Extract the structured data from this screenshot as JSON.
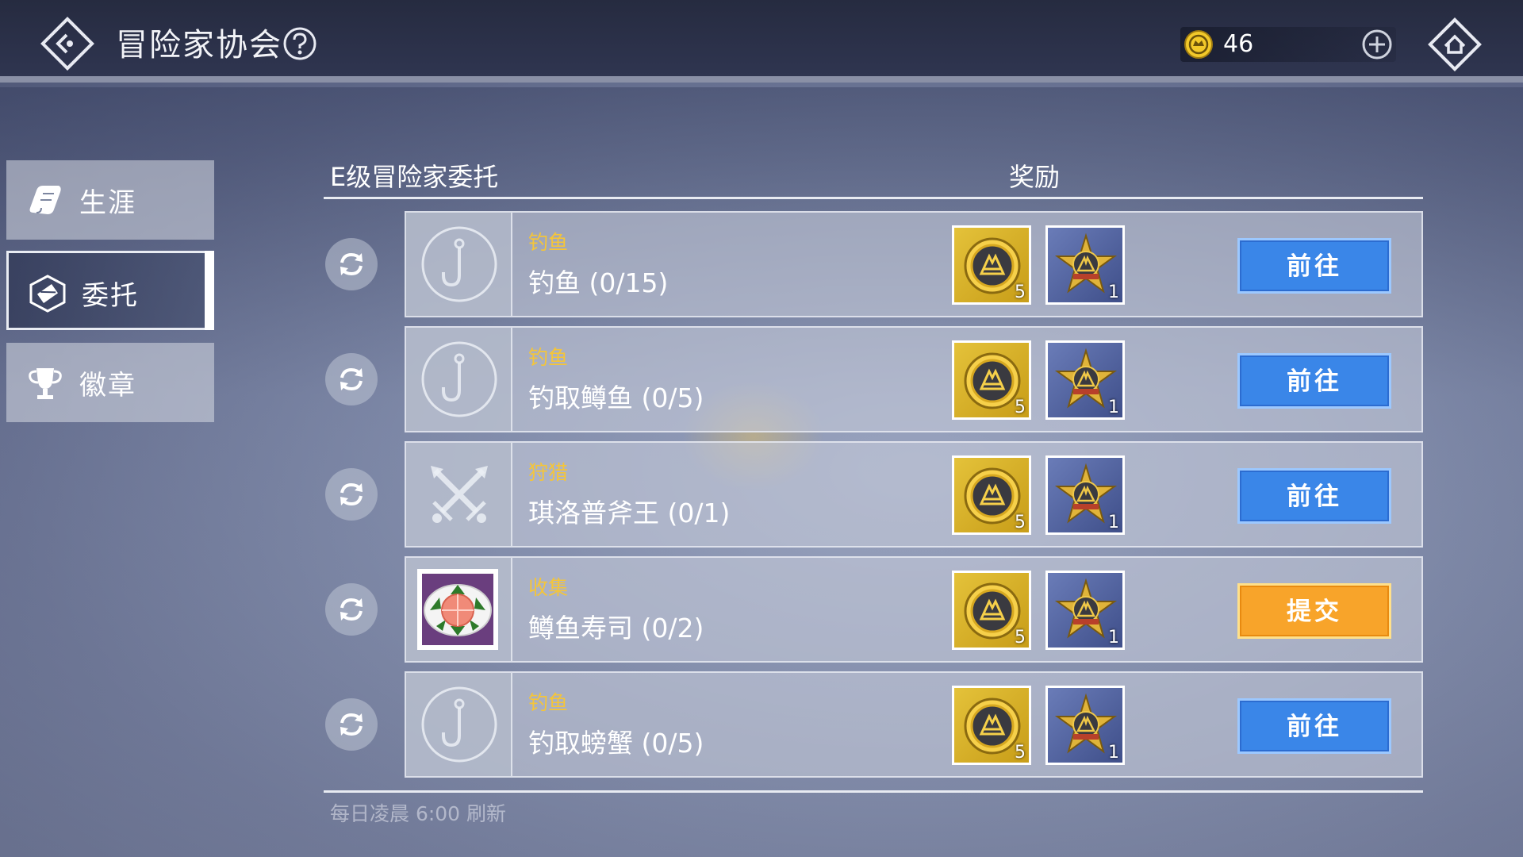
{
  "header": {
    "title": "冒险家协会",
    "coin_value": "46"
  },
  "sidebar": {
    "items": [
      {
        "label": "生涯",
        "icon": "scroll-icon"
      },
      {
        "label": "委托",
        "icon": "commission-icon"
      },
      {
        "label": "徽章",
        "icon": "trophy-icon"
      }
    ],
    "active_index": 1
  },
  "list": {
    "title": "E级冒险家委托",
    "reward_header": "奖励",
    "refresh_note": "每日凌晨 6:00 刷新",
    "rows": [
      {
        "category": "钓鱼",
        "name": "钓鱼 (0/15)",
        "icon": "fishing-hook-icon",
        "reward_gold": "5",
        "reward_badge": "1",
        "action": "前往"
      },
      {
        "category": "钓鱼",
        "name": "钓取鳟鱼 (0/5)",
        "icon": "fishing-hook-icon",
        "reward_gold": "5",
        "reward_badge": "1",
        "action": "前往"
      },
      {
        "category": "狩猎",
        "name": "琪洛普斧王 (0/1)",
        "icon": "crossed-swords-icon",
        "reward_gold": "5",
        "reward_badge": "1",
        "action": "前往"
      },
      {
        "category": "收集",
        "name": "鳟鱼寿司 (0/2)",
        "icon": "trout-sushi-icon",
        "reward_gold": "5",
        "reward_badge": "1",
        "action": "提交"
      },
      {
        "category": "钓鱼",
        "name": "钓取螃蟹 (0/5)",
        "icon": "fishing-hook-icon",
        "reward_gold": "5",
        "reward_badge": "1",
        "action": "前往"
      }
    ]
  },
  "colors": {
    "category_yellow": "#f4c53a",
    "go_button_blue": "#3a86e8",
    "submit_button_orange": "#f8a42a",
    "topbar": "#262b40"
  }
}
